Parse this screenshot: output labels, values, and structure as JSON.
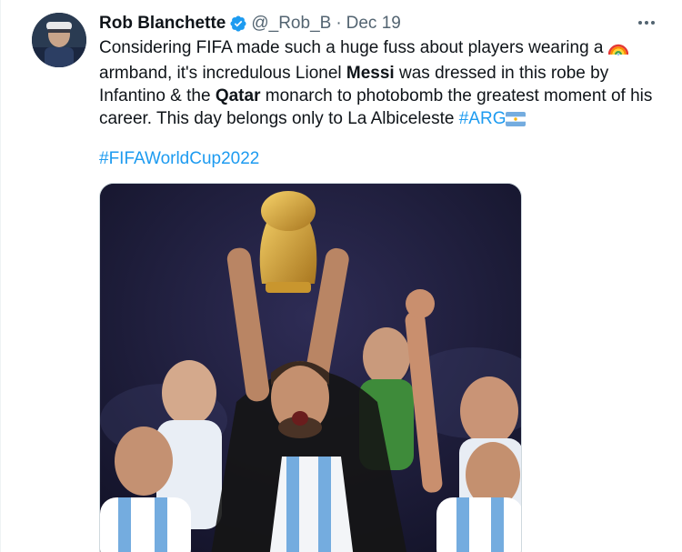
{
  "author": {
    "name": "Rob Blanchette",
    "handle": "@_Rob_B",
    "separator": "·",
    "date": "Dec 19",
    "verified": true
  },
  "more_icon": "more-icon",
  "tweet": {
    "text_1": "Considering FIFA made such a huge fuss about players wearing a ",
    "text_2": " armband, it's incredulous Lionel ",
    "bold_1": "Messi",
    "text_3": " was dressed in this robe by Infantino & the ",
    "bold_2": "Qatar",
    "text_4": " monarch to photobomb the greatest moment of his career. This day belongs only to La Albiceleste ",
    "hashtag_1": "#ARG",
    "hashtag_2": "#FIFAWorldCup2022",
    "emoji_1": "rainbow-emoji",
    "emoji_2": "argentina-flag-emoji"
  },
  "media": {
    "type": "photo"
  },
  "colors": {
    "link": "#1d9bf0",
    "text": "#0f1419",
    "secondary": "#536471",
    "verified": "#1d9bf0"
  }
}
